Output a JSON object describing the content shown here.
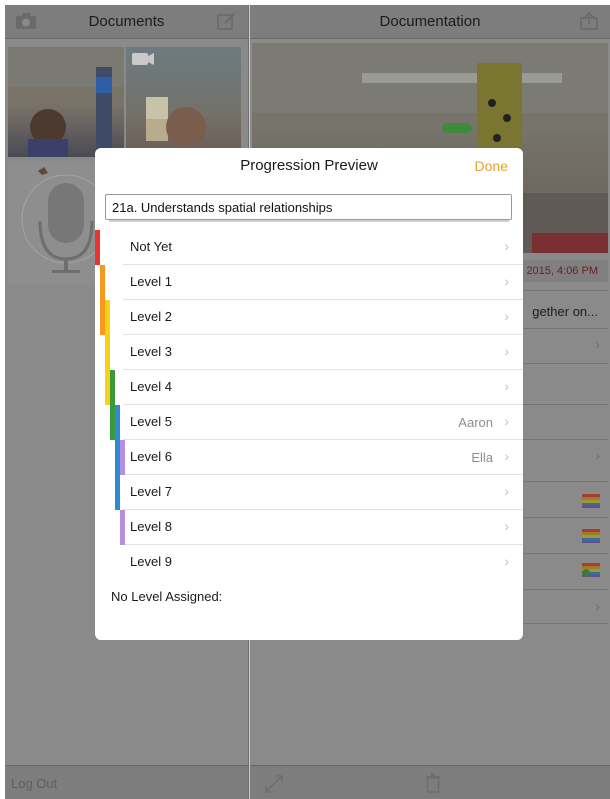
{
  "left_pane": {
    "title": "Documents",
    "camera_icon": "camera-icon",
    "compose_icon": "compose-icon",
    "logout_label": "Log Out"
  },
  "right_pane": {
    "title": "Documentation",
    "share_icon": "share-icon",
    "hero_date": "2015, 4:06 PM",
    "row_text": "gether on..."
  },
  "modal": {
    "title": "Progression Preview",
    "done_label": "Done",
    "objective_value": "21a. Understands spatial relationships",
    "no_level_label": "No Level Assigned:",
    "levels": [
      {
        "label": "Not Yet",
        "name": ""
      },
      {
        "label": "Level 1",
        "name": ""
      },
      {
        "label": "Level 2",
        "name": ""
      },
      {
        "label": "Level 3",
        "name": ""
      },
      {
        "label": "Level 4",
        "name": ""
      },
      {
        "label": "Level 5",
        "name": "Aaron"
      },
      {
        "label": "Level 6",
        "name": "Ella"
      },
      {
        "label": "Level 7",
        "name": ""
      },
      {
        "label": "Level 8",
        "name": ""
      },
      {
        "label": "Level 9",
        "name": ""
      }
    ],
    "level_colors": {
      "red": "#e8352f",
      "orange": "#f39a1c",
      "yellow": "#f5d11a",
      "green": "#3a9a3a",
      "blue": "#2f8ad6",
      "purple": "#b58fe0"
    }
  }
}
